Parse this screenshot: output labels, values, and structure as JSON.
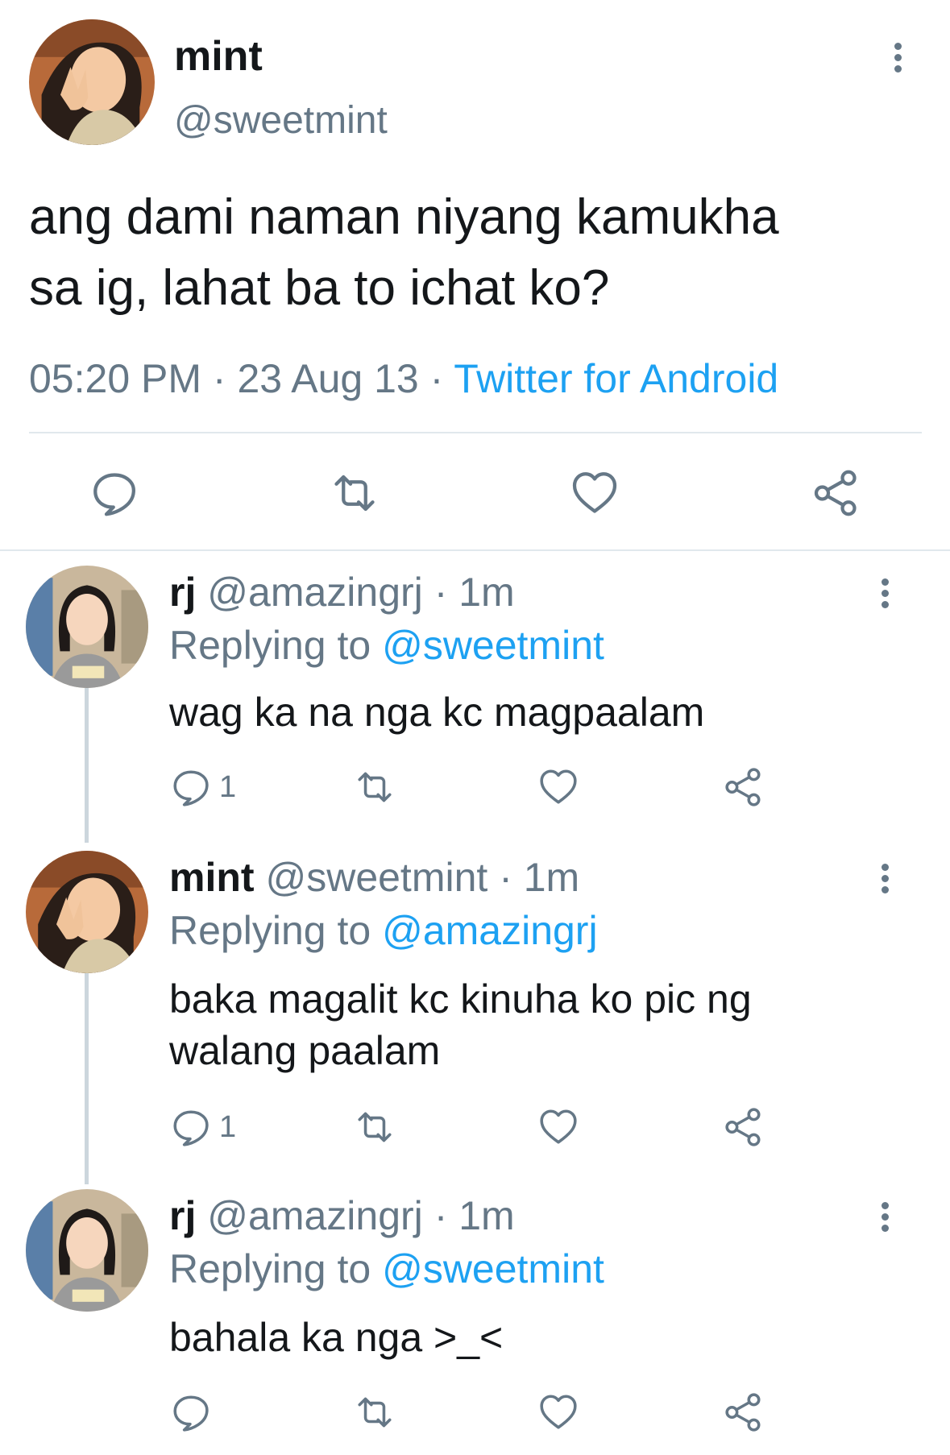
{
  "main_tweet": {
    "name": "mint",
    "handle": "@sweetmint",
    "text_line1": "ang dami naman niyang kamukha",
    "text_line2": "sa ig, lahat ba to ichat ko?",
    "time": "05:20 PM",
    "date": "23 Aug 13",
    "source": "Twitter for Android",
    "separator": "·"
  },
  "icons": {
    "reply": "reply-icon",
    "retweet": "retweet-icon",
    "like": "heart-icon",
    "share": "share-icon",
    "more": "more-vertical-icon"
  },
  "colors": {
    "accent": "#1da1f2",
    "secondary_text": "#657786",
    "divider": "#e1e8ed",
    "thread_line": "#ccd6dd"
  },
  "replies": [
    {
      "name": "rj",
      "handle": "@amazingrj",
      "age": "· 1m",
      "replying_label": "Replying to",
      "replying_to": "@sweetmint",
      "text": "wag ka na nga kc magpaalam",
      "reply_count": "1"
    },
    {
      "name": "mint",
      "handle": "@sweetmint",
      "age": "· 1m",
      "replying_label": "Replying to",
      "replying_to": "@amazingrj",
      "text_line1": "baka magalit kc kinuha ko pic ng",
      "text_line2": "walang paalam",
      "reply_count": "1"
    },
    {
      "name": "rj",
      "handle": "@amazingrj",
      "age": "· 1m",
      "replying_label": "Replying to",
      "replying_to": "@sweetmint",
      "text": "bahala ka nga >_<",
      "reply_count": ""
    }
  ]
}
